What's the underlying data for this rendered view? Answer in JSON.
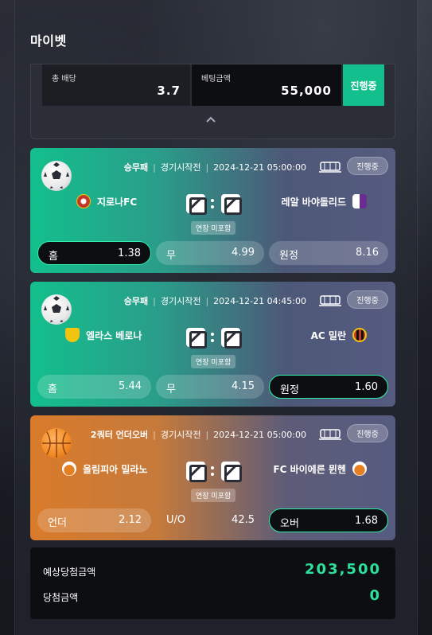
{
  "title": "마이벳",
  "summary": {
    "odds_label": "총 배당",
    "odds_value": "3.7",
    "bet_label": "베팅금액",
    "bet_value": "55,000",
    "status": "진행중"
  },
  "matches": [
    {
      "sport": "승무패",
      "start_label": "경기시작전",
      "datetime": "2024-12-21 05:00:00",
      "status": "진행중",
      "home": "지로나FC",
      "away": "레알 바야돌리드",
      "extension": "연장 미포함",
      "odds": [
        {
          "label": "홈",
          "value": "1.38"
        },
        {
          "label": "무",
          "value": "4.99"
        },
        {
          "label": "원정",
          "value": "8.16"
        }
      ]
    },
    {
      "sport": "승무패",
      "start_label": "경기시작전",
      "datetime": "2024-12-21 04:45:00",
      "status": "진행중",
      "home": "엘라스 베로나",
      "away": "AC 밀란",
      "extension": "연장 미포함",
      "odds": [
        {
          "label": "홈",
          "value": "5.44"
        },
        {
          "label": "무",
          "value": "4.15"
        },
        {
          "label": "원정",
          "value": "1.60"
        }
      ]
    },
    {
      "sport": "2쿼터 언더오버",
      "start_label": "경기시작전",
      "datetime": "2024-12-21 05:00:00",
      "status": "진행중",
      "home": "올림피아 밀라노",
      "away": "FC 바이에른 뮌헨",
      "extension": "연장 미포함",
      "odds": [
        {
          "label": "언더",
          "value": "2.12"
        },
        {
          "label": "U/O",
          "value": "42.5"
        },
        {
          "label": "오버",
          "value": "1.68"
        }
      ]
    }
  ],
  "result": {
    "expected_label": "예상당첨금액",
    "expected_value": "203,500",
    "won_label": "당첨금액",
    "won_value": "0"
  },
  "colors": {
    "accent": "#13bf8c",
    "win": "#2de09b",
    "orange": "#d97b2b"
  }
}
